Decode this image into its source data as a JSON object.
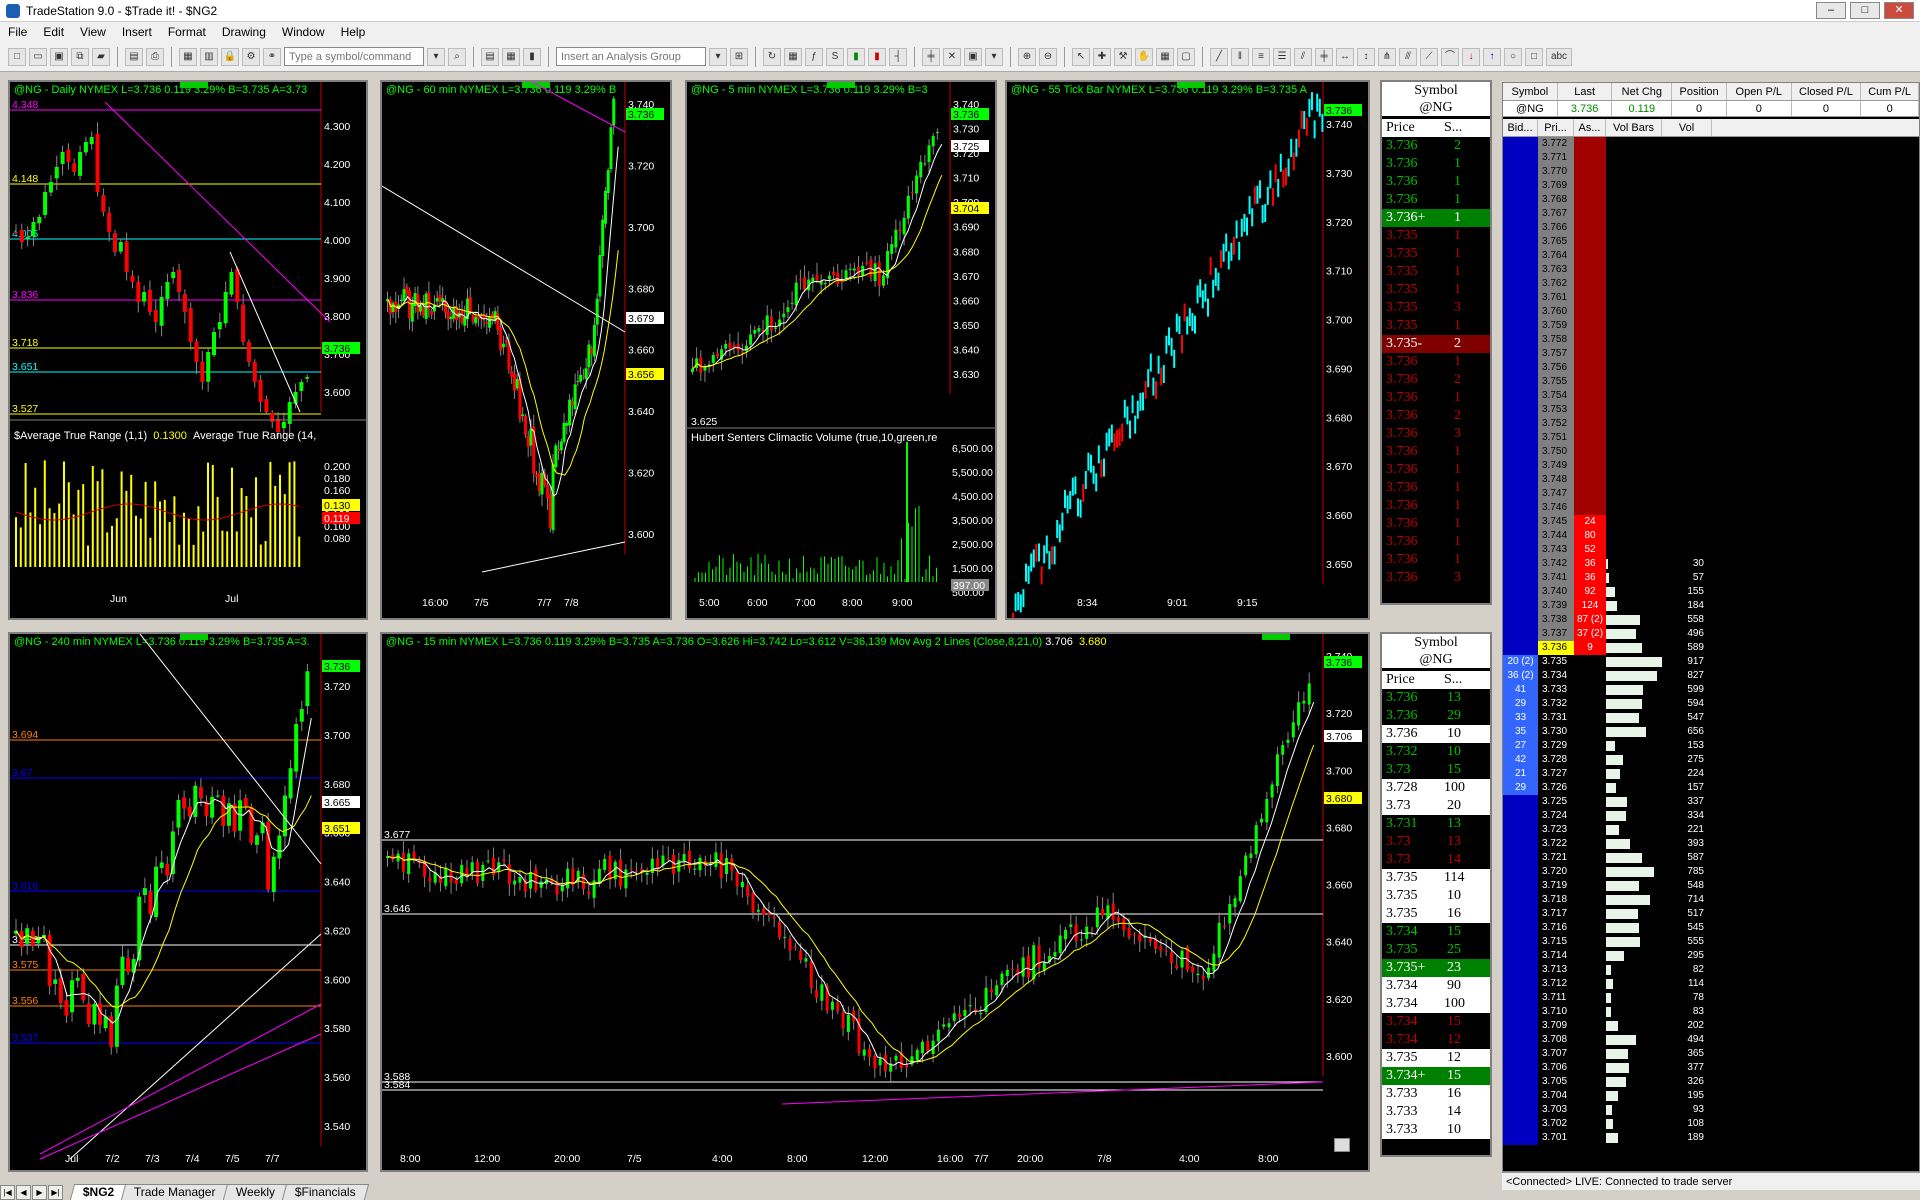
{
  "window": {
    "title": "TradeStation 9.0 - $Trade it! - $NG2"
  },
  "menu": [
    "File",
    "Edit",
    "View",
    "Insert",
    "Format",
    "Drawing",
    "Window",
    "Help"
  ],
  "toolbar": {
    "symbol_placeholder": "Type a symbol/command",
    "analysis_placeholder": "Insert an Analysis Group",
    "text_tool": "abc"
  },
  "charts": {
    "daily": {
      "header": "@NG - Daily  NYMEX  L=3.736  0.119  3.29%  B=3.735  A=3.73",
      "ticks": [
        "4.300",
        "4.200",
        "4.100",
        "4.000",
        "3.900",
        "3.800",
        "3.700",
        "3.600"
      ],
      "levels": [
        "4.348",
        "4.148",
        "4.005",
        "3.836",
        "3.718",
        "3.651",
        "3.527"
      ],
      "last_tag": "3.736",
      "sub_header_1": "$Average True Range (1,1)",
      "sub_val_1": "0.1300",
      "sub_header_2": "Average True Range (14,",
      "sub_ticks": [
        "0.200",
        "0.180",
        "0.160",
        "0.140",
        "0.120",
        "0.100",
        "0.080"
      ],
      "sub_tag_1": "0.130",
      "sub_tag_2": "0.119",
      "xlabels": [
        "Jun",
        "Jul"
      ]
    },
    "min60": {
      "header": "@NG - 60 min  NYMEX  L=3.736  0.119  3.29%  B",
      "ticks": [
        "3.740",
        "3.720",
        "3.700",
        "3.680",
        "3.660",
        "3.640",
        "3.620",
        "3.600"
      ],
      "tags": [
        "3.736",
        "3.679",
        "3.656"
      ],
      "xlabels": [
        "16:00",
        "7/5",
        "7/7",
        "7/8"
      ]
    },
    "min5": {
      "header": "@NG - 5 min  NYMEX  L=3.736  0.119  3.29%  B=3",
      "ticks": [
        "3.740",
        "3.730",
        "3.720",
        "3.710",
        "3.700",
        "3.690",
        "3.680",
        "3.670",
        "3.660",
        "3.650",
        "3.640",
        "3.630"
      ],
      "tags": [
        "3.736",
        "3.725",
        "3.704"
      ],
      "level": "3.625",
      "sub_header": "Hubert Senters Climactic Volume (true,10,green,re",
      "vol_ticks": [
        "6,500.00",
        "5,500.00",
        "4,500.00",
        "3,500.00",
        "2,500.00",
        "1,500.00",
        "500.00"
      ],
      "vol_tag": "397.00",
      "xlabels": [
        "5:00",
        "6:00",
        "7:00",
        "8:00",
        "9:00"
      ]
    },
    "tick55": {
      "header": "@NG - 55 Tick Bar  NYMEX  L=3.736  0.119  3.29%  B=3.735  A",
      "ticks": [
        "3.740",
        "3.730",
        "3.720",
        "3.710",
        "3.700",
        "3.690",
        "3.680",
        "3.670",
        "3.660",
        "3.650"
      ],
      "tag": "3.736",
      "xlabels": [
        "8:34",
        "9:01",
        "9:15"
      ]
    },
    "min240": {
      "header": "@NG - 240 min  NYMEX  L=3.736  0.119  3.29%  B=3.735  A=3.",
      "ticks": [
        "3.720",
        "3.700",
        "3.680",
        "3.660",
        "3.640",
        "3.620",
        "3.600",
        "3.580",
        "3.560",
        "3.540"
      ],
      "tags": [
        "3.736",
        "3.665",
        "3.651"
      ],
      "levels": [
        "3.694",
        "3.67",
        "3.616",
        "3.588",
        "3.575",
        "3.556",
        "3.537"
      ],
      "xlabels": [
        "Jul",
        "7/2",
        "7/3",
        "7/4",
        "7/5",
        "7/7"
      ]
    },
    "min15": {
      "header": "@NG - 15 min  NYMEX  L=3.736  0.119  3.29%  B=3.735  A=3.736  O=3.626  Hi=3.742  Lo=3.612  V=36,139  Mov Avg 2 Lines (Close,8,21,0)  ",
      "ma1": "3.706",
      "ma2": "3.680",
      "ticks": [
        "3.740",
        "3.720",
        "3.700",
        "3.680",
        "3.660",
        "3.640",
        "3.620",
        "3.600"
      ],
      "tags": [
        "3.736",
        "3.706",
        "3.680"
      ],
      "levels": [
        "3.677",
        "3.646",
        "3.588",
        "3.584"
      ],
      "xlabels": [
        "8:00",
        "12:00",
        "20:00",
        "7/5",
        "4:00",
        "8:00",
        "12:00",
        "16:00",
        "7/7",
        "20:00",
        "7/8",
        "4:00",
        "8:00"
      ]
    }
  },
  "ladder1": {
    "title": "Symbol",
    "symbol": "@NG",
    "col_price": "Price",
    "col_size": "S...",
    "rows": [
      {
        "p": "3.736",
        "s": "2",
        "c": "g"
      },
      {
        "p": "3.736",
        "s": "1",
        "c": "g"
      },
      {
        "p": "3.736",
        "s": "1",
        "c": "g"
      },
      {
        "p": "3.736",
        "s": "1",
        "c": "g"
      },
      {
        "p": "3.736+",
        "s": "1",
        "c": "gb"
      },
      {
        "p": "3.735",
        "s": "1",
        "c": "r"
      },
      {
        "p": "3.735",
        "s": "1",
        "c": "r"
      },
      {
        "p": "3.735",
        "s": "1",
        "c": "r"
      },
      {
        "p": "3.735",
        "s": "1",
        "c": "r"
      },
      {
        "p": "3.735",
        "s": "3",
        "c": "r"
      },
      {
        "p": "3.735",
        "s": "1",
        "c": "r"
      },
      {
        "p": "3.735-",
        "s": "2",
        "c": "rb"
      },
      {
        "p": "3.736",
        "s": "1",
        "c": "r"
      },
      {
        "p": "3.736",
        "s": "2",
        "c": "r"
      },
      {
        "p": "3.736",
        "s": "1",
        "c": "r"
      },
      {
        "p": "3.736",
        "s": "2",
        "c": "r"
      },
      {
        "p": "3.736",
        "s": "3",
        "c": "r"
      },
      {
        "p": "3.736",
        "s": "1",
        "c": "r"
      },
      {
        "p": "3.736",
        "s": "1",
        "c": "r"
      },
      {
        "p": "3.736",
        "s": "1",
        "c": "r"
      },
      {
        "p": "3.736",
        "s": "1",
        "c": "r"
      },
      {
        "p": "3.736",
        "s": "1",
        "c": "r"
      },
      {
        "p": "3.736",
        "s": "1",
        "c": "r"
      },
      {
        "p": "3.736",
        "s": "1",
        "c": "r"
      },
      {
        "p": "3.736",
        "s": "3",
        "c": "r"
      }
    ]
  },
  "ladder2": {
    "title": "Symbol",
    "symbol": "@NG",
    "col_price": "Price",
    "col_size": "S...",
    "rows": [
      {
        "p": "3.736",
        "s": "13",
        "c": "g"
      },
      {
        "p": "3.736",
        "s": "29",
        "c": "g"
      },
      {
        "p": "3.736",
        "s": "10",
        "c": "w"
      },
      {
        "p": "3.732",
        "s": "10",
        "c": "g"
      },
      {
        "p": "3.73",
        "s": "15",
        "c": "g"
      },
      {
        "p": "3.728",
        "s": "100",
        "c": "w"
      },
      {
        "p": "3.73",
        "s": "20",
        "c": "w"
      },
      {
        "p": "3.731",
        "s": "13",
        "c": "g"
      },
      {
        "p": "3.73",
        "s": "13",
        "c": "r"
      },
      {
        "p": "3.73",
        "s": "14",
        "c": "r"
      },
      {
        "p": "3.735",
        "s": "114",
        "c": "w"
      },
      {
        "p": "3.735",
        "s": "10",
        "c": "w"
      },
      {
        "p": "3.735",
        "s": "16",
        "c": "w"
      },
      {
        "p": "3.734",
        "s": "15",
        "c": "g"
      },
      {
        "p": "3.735",
        "s": "25",
        "c": "g"
      },
      {
        "p": "3.735+",
        "s": "23",
        "c": "gb"
      },
      {
        "p": "3.734",
        "s": "90",
        "c": "w"
      },
      {
        "p": "3.734",
        "s": "100",
        "c": "w"
      },
      {
        "p": "3.734",
        "s": "15",
        "c": "r"
      },
      {
        "p": "3.734",
        "s": "12",
        "c": "r"
      },
      {
        "p": "3.735",
        "s": "12",
        "c": "w"
      },
      {
        "p": "3.734+",
        "s": "15",
        "c": "gb"
      },
      {
        "p": "3.733",
        "s": "16",
        "c": "w"
      },
      {
        "p": "3.733",
        "s": "14",
        "c": "w"
      },
      {
        "p": "3.733",
        "s": "10",
        "c": "w"
      }
    ]
  },
  "dom": {
    "headers": [
      "Symbol",
      "Last",
      "Net Chg",
      "Position",
      "Open P/L",
      "Closed P/L",
      "Cum P/L"
    ],
    "values": [
      "@NG",
      "3.736",
      "0.119",
      "0",
      "0",
      "0",
      "0"
    ],
    "col_headers": [
      "Bid...",
      "Pri...",
      "As...",
      "Vol Bars",
      "Vol"
    ],
    "rows": [
      {
        "b": "",
        "p": "3.772",
        "a": "",
        "v": ""
      },
      {
        "b": "",
        "p": "3.771",
        "a": "",
        "v": ""
      },
      {
        "b": "",
        "p": "3.770",
        "a": "",
        "v": ""
      },
      {
        "b": "",
        "p": "3.769",
        "a": "",
        "v": ""
      },
      {
        "b": "",
        "p": "3.768",
        "a": "",
        "v": ""
      },
      {
        "b": "",
        "p": "3.767",
        "a": "",
        "v": ""
      },
      {
        "b": "",
        "p": "3.766",
        "a": "",
        "v": ""
      },
      {
        "b": "",
        "p": "3.765",
        "a": "",
        "v": ""
      },
      {
        "b": "",
        "p": "3.764",
        "a": "",
        "v": ""
      },
      {
        "b": "",
        "p": "3.763",
        "a": "",
        "v": ""
      },
      {
        "b": "",
        "p": "3.762",
        "a": "",
        "v": ""
      },
      {
        "b": "",
        "p": "3.761",
        "a": "",
        "v": ""
      },
      {
        "b": "",
        "p": "3.760",
        "a": "",
        "v": ""
      },
      {
        "b": "",
        "p": "3.759",
        "a": "",
        "v": ""
      },
      {
        "b": "",
        "p": "3.758",
        "a": "",
        "v": ""
      },
      {
        "b": "",
        "p": "3.757",
        "a": "",
        "v": ""
      },
      {
        "b": "",
        "p": "3.756",
        "a": "",
        "v": ""
      },
      {
        "b": "",
        "p": "3.755",
        "a": "",
        "v": ""
      },
      {
        "b": "",
        "p": "3.754",
        "a": "",
        "v": ""
      },
      {
        "b": "",
        "p": "3.753",
        "a": "",
        "v": ""
      },
      {
        "b": "",
        "p": "3.752",
        "a": "",
        "v": ""
      },
      {
        "b": "",
        "p": "3.751",
        "a": "",
        "v": ""
      },
      {
        "b": "",
        "p": "3.750",
        "a": "",
        "v": ""
      },
      {
        "b": "",
        "p": "3.749",
        "a": "",
        "v": ""
      },
      {
        "b": "",
        "p": "3.748",
        "a": "",
        "v": ""
      },
      {
        "b": "",
        "p": "3.747",
        "a": "",
        "v": ""
      },
      {
        "b": "",
        "p": "3.746",
        "a": "",
        "v": ""
      },
      {
        "b": "",
        "p": "3.745",
        "a": "24",
        "v": ""
      },
      {
        "b": "",
        "p": "3.744",
        "a": "80",
        "v": ""
      },
      {
        "b": "",
        "p": "3.743",
        "a": "52",
        "v": ""
      },
      {
        "b": "",
        "p": "3.742",
        "a": "36",
        "v": "30"
      },
      {
        "b": "",
        "p": "3.741",
        "a": "36",
        "v": "57"
      },
      {
        "b": "",
        "p": "3.740",
        "a": "92",
        "v": "155"
      },
      {
        "b": "",
        "p": "3.739",
        "a": "124",
        "v": "184"
      },
      {
        "b": "",
        "p": "3.738",
        "a": "87 (2)",
        "v": "558"
      },
      {
        "b": "",
        "p": "3.737",
        "a": "37 (2)",
        "v": "496"
      },
      {
        "b": "",
        "p": "3.736",
        "a": "9",
        "v": "589"
      },
      {
        "b": "20 (2)",
        "p": "3.735",
        "a": "",
        "v": "917"
      },
      {
        "b": "36 (2)",
        "p": "3.734",
        "a": "",
        "v": "827"
      },
      {
        "b": "41",
        "p": "3.733",
        "a": "",
        "v": "599"
      },
      {
        "b": "29",
        "p": "3.732",
        "a": "",
        "v": "594"
      },
      {
        "b": "33",
        "p": "3.731",
        "a": "",
        "v": "547"
      },
      {
        "b": "35",
        "p": "3.730",
        "a": "",
        "v": "656"
      },
      {
        "b": "27",
        "p": "3.729",
        "a": "",
        "v": "153"
      },
      {
        "b": "42",
        "p": "3.728",
        "a": "",
        "v": "275"
      },
      {
        "b": "21",
        "p": "3.727",
        "a": "",
        "v": "224"
      },
      {
        "b": "29",
        "p": "3.726",
        "a": "",
        "v": "157"
      },
      {
        "b": "",
        "p": "3.725",
        "a": "",
        "v": "337"
      },
      {
        "b": "",
        "p": "3.724",
        "a": "",
        "v": "334"
      },
      {
        "b": "",
        "p": "3.723",
        "a": "",
        "v": "221"
      },
      {
        "b": "",
        "p": "3.722",
        "a": "",
        "v": "393"
      },
      {
        "b": "",
        "p": "3.721",
        "a": "",
        "v": "587"
      },
      {
        "b": "",
        "p": "3.720",
        "a": "",
        "v": "785"
      },
      {
        "b": "",
        "p": "3.719",
        "a": "",
        "v": "548"
      },
      {
        "b": "",
        "p": "3.718",
        "a": "",
        "v": "714"
      },
      {
        "b": "",
        "p": "3.717",
        "a": "",
        "v": "517"
      },
      {
        "b": "",
        "p": "3.716",
        "a": "",
        "v": "545"
      },
      {
        "b": "",
        "p": "3.715",
        "a": "",
        "v": "555"
      },
      {
        "b": "",
        "p": "3.714",
        "a": "",
        "v": "295"
      },
      {
        "b": "",
        "p": "3.713",
        "a": "",
        "v": "82"
      },
      {
        "b": "",
        "p": "3.712",
        "a": "",
        "v": "114"
      },
      {
        "b": "",
        "p": "3.711",
        "a": "",
        "v": "78"
      },
      {
        "b": "",
        "p": "3.710",
        "a": "",
        "v": "83"
      },
      {
        "b": "",
        "p": "3.709",
        "a": "",
        "v": "202"
      },
      {
        "b": "",
        "p": "3.708",
        "a": "",
        "v": "494"
      },
      {
        "b": "",
        "p": "3.707",
        "a": "",
        "v": "365"
      },
      {
        "b": "",
        "p": "3.706",
        "a": "",
        "v": "377"
      },
      {
        "b": "",
        "p": "3.705",
        "a": "",
        "v": "326"
      },
      {
        "b": "",
        "p": "3.704",
        "a": "",
        "v": "195"
      },
      {
        "b": "",
        "p": "3.703",
        "a": "",
        "v": "93"
      },
      {
        "b": "",
        "p": "3.702",
        "a": "",
        "v": "108"
      },
      {
        "b": "",
        "p": "3.701",
        "a": "",
        "v": "189"
      }
    ],
    "status": "<Connected>  LIVE:  Connected to trade server"
  },
  "tabs": [
    "$NG2",
    "Trade Manager",
    "Weekly",
    "$Financials"
  ],
  "colors": {
    "up": "#00ff00",
    "down": "#ff0000",
    "bid": "#0000c0",
    "ask": "#a00000",
    "cyan": "#00ffff",
    "magenta": "#ff00ff",
    "yellow": "#ffff00"
  }
}
